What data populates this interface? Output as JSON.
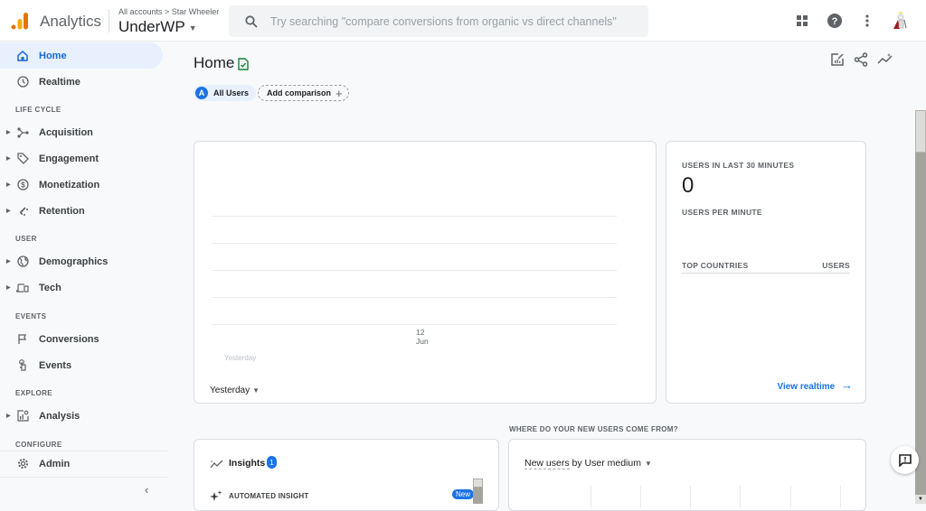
{
  "header": {
    "app_name": "Analytics",
    "breadcrumb": "All accounts > Star Wheeler",
    "property": "UnderWP",
    "search_placeholder": "Try searching \"compare conversions from organic vs direct channels\"",
    "icons": [
      "apps-grid-icon",
      "help-icon",
      "more-vert-icon",
      "avatar"
    ]
  },
  "sidebar": {
    "items": [
      {
        "label": "Home",
        "icon": "home-icon",
        "active": true
      },
      {
        "label": "Realtime",
        "icon": "clock-icon"
      },
      {
        "label": "Acquisition",
        "icon": "acquisition-icon",
        "expandable": true
      },
      {
        "label": "Engagement",
        "icon": "tag-icon",
        "expandable": true
      },
      {
        "label": "Monetization",
        "icon": "dollar-icon",
        "expandable": true
      },
      {
        "label": "Retention",
        "icon": "magnet-icon",
        "expandable": true
      },
      {
        "label": "Demographics",
        "icon": "globe-icon",
        "expandable": true
      },
      {
        "label": "Tech",
        "icon": "devices-icon",
        "expandable": true
      },
      {
        "label": "Conversions",
        "icon": "flag-icon"
      },
      {
        "label": "Events",
        "icon": "touch-icon"
      },
      {
        "label": "Analysis",
        "icon": "analysis-icon",
        "expandable": true
      },
      {
        "label": "Admin",
        "icon": "gear-icon"
      }
    ],
    "sections": [
      "LIFE CYCLE",
      "USER",
      "EVENTS",
      "EXPLORE",
      "CONFIGURE"
    ],
    "collapse": "‹"
  },
  "main": {
    "title": "Home",
    "comparison": {
      "all_users_avatar": "A",
      "all_users": "All Users",
      "add_label": "Add comparison",
      "add_icon": "+"
    },
    "chart_card": {
      "x_tick_day": "12",
      "x_tick_month": "Jun",
      "ghost_label": "Yesterday",
      "date_range": "Yesterday"
    },
    "realtime_card": {
      "users_30_label": "USERS IN LAST 30 MINUTES",
      "users_30_value": "0",
      "per_minute_label": "USERS PER MINUTE",
      "top_countries": "TOP COUNTRIES",
      "users_col": "USERS",
      "link": "View realtime",
      "link_arrow": "→"
    },
    "new_users_section": "WHERE DO YOUR NEW USERS COME FROM?",
    "insights_card": {
      "title": "Insights",
      "count": "1",
      "automated": "AUTOMATED INSIGHT",
      "new_badge": "New"
    },
    "new_users_card": {
      "metric": "New users",
      "rest": " by User medium"
    }
  },
  "colors": {
    "accent": "#1a73e8",
    "active_bg": "#e8f0fe",
    "logo_orange": "#f9ab00",
    "logo_dark": "#e37400"
  }
}
